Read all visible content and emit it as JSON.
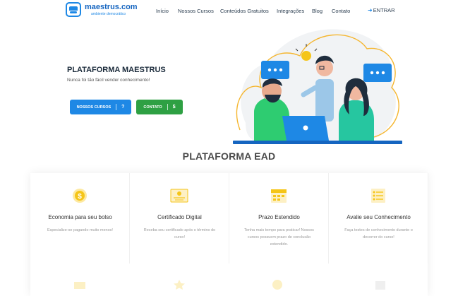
{
  "header": {
    "logo_text": "maestrus.com",
    "logo_sub": "ambiente democrático",
    "nav": [
      "Início",
      "Nossos Cursos",
      "Conteúdos Gratuitos",
      "Integrações",
      "Blog",
      "Contato"
    ],
    "login_label": "ENTRAR"
  },
  "hero": {
    "title": "PLATAFORMA MAESTRUS",
    "subtitle": "Nunca foi tão fácil vender conhecimento!",
    "btn_courses": "NOSSOS CURSOS",
    "btn_courses_glyph": "?",
    "btn_contact": "CONTATO",
    "btn_contact_glyph": "$"
  },
  "section": {
    "title": "PLATAFORMA EAD",
    "cards": [
      {
        "title": "Economia para seu bolso",
        "desc": "Especialize-se pagando muito menos!",
        "icon": "coin-icon"
      },
      {
        "title": "Certificado Digital",
        "desc": "Receba seu certificado após o término do curso!",
        "icon": "certificate-icon"
      },
      {
        "title": "Prazo Estendido",
        "desc": "Tenha mais tempo para praticar! Nossos cursos possuem prazo de conclusão estendido.",
        "icon": "calendar-icon"
      },
      {
        "title": "Avalie seu Conhecimento",
        "desc": "Faça testes de conhecimento durante o decorrer do curso!",
        "icon": "checklist-icon"
      }
    ]
  },
  "colors": {
    "primary": "#1e88e5",
    "success": "#2ea043",
    "accent": "#f5c518"
  }
}
